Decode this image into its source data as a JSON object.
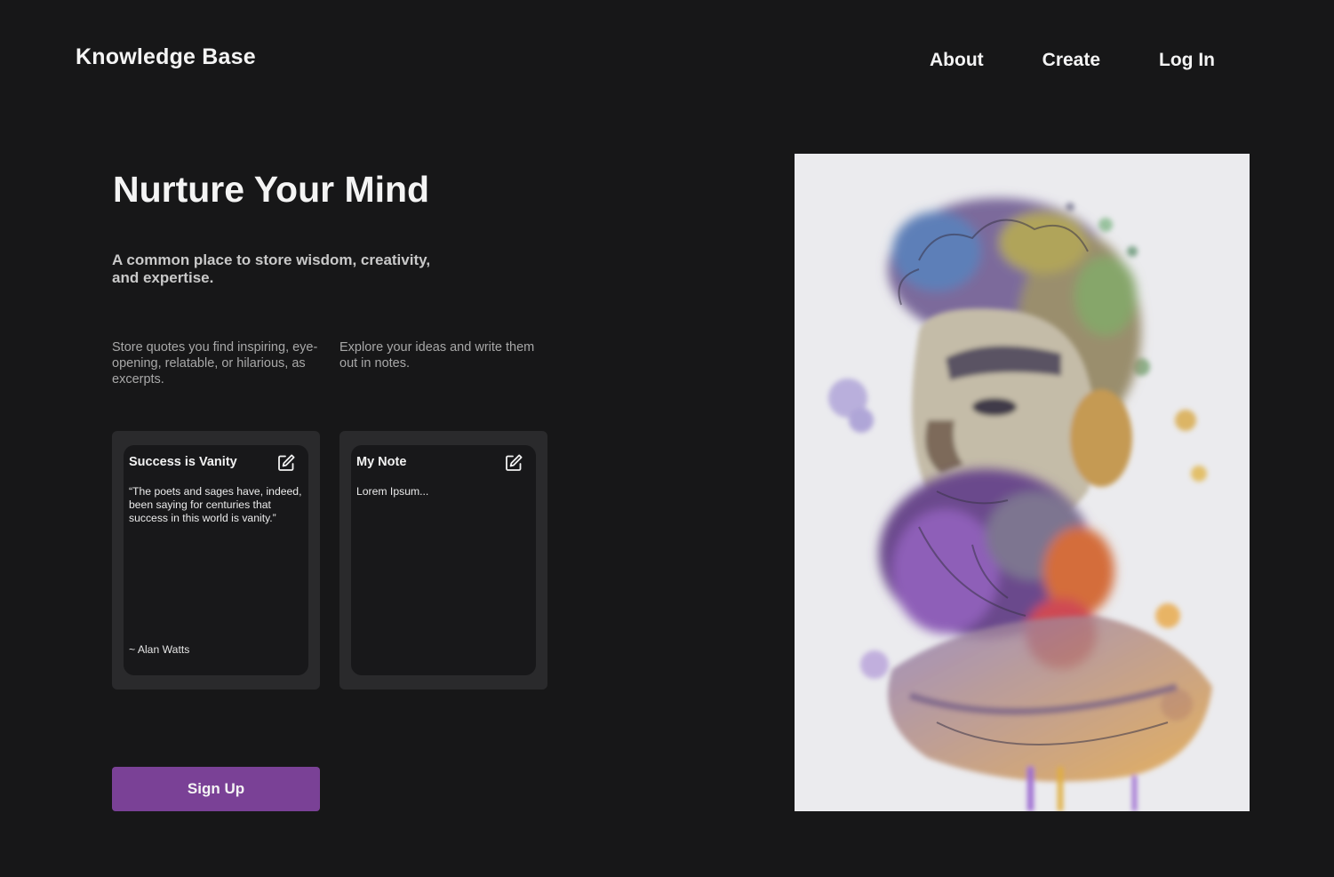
{
  "header": {
    "brand": "Knowledge Base",
    "nav": {
      "about": "About",
      "create": "Create",
      "login": "Log In"
    }
  },
  "hero": {
    "title": "Nurture Your Mind",
    "subtitle": "A common place to store wisdom, creativity, and expertise."
  },
  "features": {
    "quotes_text": "Store quotes you find inspiring, eye-opening, relatable, or hilarious, as excerpts.",
    "notes_text": "Explore your ideas and write them out in notes."
  },
  "cards": {
    "quote": {
      "title": "Success is Vanity",
      "body": "“The poets and sages have, indeed, been saying for centuries that success in this world is vanity.”",
      "author": "~ Alan Watts",
      "icon": "edit-icon"
    },
    "note": {
      "title": "My Note",
      "body": "Lorem Ipsum...",
      "icon": "edit-icon"
    }
  },
  "cta": {
    "signup_label": "Sign Up"
  },
  "colors": {
    "background": "#171718",
    "card_outer": "#2a2a2c",
    "card_inner": "#18181a",
    "accent": "#7a4196"
  }
}
